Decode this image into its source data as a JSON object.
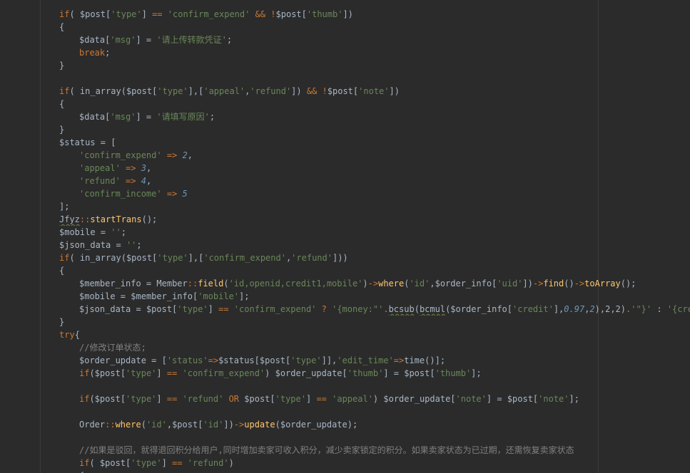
{
  "editor": {
    "colors": {
      "background": "#2b2b2b",
      "default_text": "#a9b7c6",
      "keyword": "#cc7832",
      "string": "#6a8759",
      "number": "#6897bb",
      "function": "#ffc66d",
      "comment": "#808080"
    },
    "lines": [
      {
        "indent": 7,
        "tokens": [
          [
            "kw",
            "if"
          ],
          [
            "punc",
            "( "
          ],
          [
            "var",
            "$post"
          ],
          [
            "punc",
            "["
          ],
          [
            "str",
            "'type'"
          ],
          [
            "punc",
            "] "
          ],
          [
            "op",
            "=="
          ],
          [
            "punc",
            " "
          ],
          [
            "str",
            "'confirm_expend'"
          ],
          [
            "punc",
            " "
          ],
          [
            "op",
            "&&"
          ],
          [
            "punc",
            " "
          ],
          [
            "op",
            "!"
          ],
          [
            "var",
            "$post"
          ],
          [
            "punc",
            "["
          ],
          [
            "str",
            "'thumb'"
          ],
          [
            "punc",
            "])"
          ]
        ]
      },
      {
        "indent": 7,
        "tokens": [
          [
            "punc",
            "{"
          ]
        ]
      },
      {
        "indent": 11,
        "tokens": [
          [
            "var",
            "$data"
          ],
          [
            "punc",
            "["
          ],
          [
            "str",
            "'msg'"
          ],
          [
            "punc",
            "] = "
          ],
          [
            "str",
            "'请上传转款凭证'"
          ],
          [
            "punc",
            ";"
          ]
        ]
      },
      {
        "indent": 11,
        "tokens": [
          [
            "kw",
            "break"
          ],
          [
            "punc",
            ";"
          ]
        ]
      },
      {
        "indent": 7,
        "tokens": [
          [
            "punc",
            "}"
          ]
        ]
      },
      {
        "indent": 7,
        "tokens": []
      },
      {
        "indent": 7,
        "tokens": [
          [
            "kw",
            "if"
          ],
          [
            "punc",
            "( "
          ],
          [
            "plain",
            "in_array("
          ],
          [
            "var",
            "$post"
          ],
          [
            "punc",
            "["
          ],
          [
            "str",
            "'type'"
          ],
          [
            "punc",
            "],["
          ],
          [
            "str",
            "'appeal'"
          ],
          [
            "punc",
            ","
          ],
          [
            "str",
            "'refund'"
          ],
          [
            "punc",
            "]) "
          ],
          [
            "op",
            "&&"
          ],
          [
            "punc",
            " "
          ],
          [
            "op",
            "!"
          ],
          [
            "var",
            "$post"
          ],
          [
            "punc",
            "["
          ],
          [
            "str",
            "'note'"
          ],
          [
            "punc",
            "])"
          ]
        ]
      },
      {
        "indent": 7,
        "tokens": [
          [
            "punc",
            "{"
          ]
        ]
      },
      {
        "indent": 11,
        "tokens": [
          [
            "var",
            "$data"
          ],
          [
            "punc",
            "["
          ],
          [
            "str",
            "'msg'"
          ],
          [
            "punc",
            "] = "
          ],
          [
            "str",
            "'请填写原因'"
          ],
          [
            "punc",
            ";"
          ]
        ]
      },
      {
        "indent": 7,
        "tokens": [
          [
            "punc",
            "}"
          ]
        ]
      },
      {
        "indent": 7,
        "tokens": [
          [
            "var",
            "$status"
          ],
          [
            "punc",
            " = ["
          ]
        ]
      },
      {
        "indent": 11,
        "tokens": [
          [
            "str",
            "'confirm_expend'"
          ],
          [
            "punc",
            " "
          ],
          [
            "op",
            "=>"
          ],
          [
            "punc",
            " "
          ],
          [
            "num",
            "2"
          ],
          [
            "punc",
            ","
          ]
        ]
      },
      {
        "indent": 11,
        "tokens": [
          [
            "str",
            "'appeal'"
          ],
          [
            "punc",
            " "
          ],
          [
            "op",
            "=>"
          ],
          [
            "punc",
            " "
          ],
          [
            "num",
            "3"
          ],
          [
            "punc",
            ","
          ]
        ]
      },
      {
        "indent": 11,
        "tokens": [
          [
            "str",
            "'refund'"
          ],
          [
            "punc",
            " "
          ],
          [
            "op",
            "=>"
          ],
          [
            "punc",
            " "
          ],
          [
            "num",
            "4"
          ],
          [
            "punc",
            ","
          ]
        ]
      },
      {
        "indent": 11,
        "tokens": [
          [
            "str",
            "'confirm_income'"
          ],
          [
            "punc",
            " "
          ],
          [
            "op",
            "=>"
          ],
          [
            "punc",
            " "
          ],
          [
            "num",
            "5"
          ]
        ]
      },
      {
        "indent": 7,
        "tokens": [
          [
            "punc",
            "];"
          ]
        ]
      },
      {
        "indent": 7,
        "tokens": [
          [
            "squig",
            "Jfyz"
          ],
          [
            "op",
            "::"
          ],
          [
            "fn",
            "startTrans"
          ],
          [
            "punc",
            "();"
          ]
        ]
      },
      {
        "indent": 7,
        "tokens": [
          [
            "var",
            "$mobile"
          ],
          [
            "punc",
            " = "
          ],
          [
            "str",
            "''"
          ],
          [
            "punc",
            ";"
          ]
        ]
      },
      {
        "indent": 7,
        "tokens": [
          [
            "var",
            "$json_data"
          ],
          [
            "punc",
            " = "
          ],
          [
            "str",
            "''"
          ],
          [
            "punc",
            ";"
          ]
        ]
      },
      {
        "indent": 7,
        "tokens": [
          [
            "kw",
            "if"
          ],
          [
            "punc",
            "( "
          ],
          [
            "plain",
            "in_array("
          ],
          [
            "var",
            "$post"
          ],
          [
            "punc",
            "["
          ],
          [
            "str",
            "'type'"
          ],
          [
            "punc",
            "],["
          ],
          [
            "str",
            "'confirm_expend'"
          ],
          [
            "punc",
            ","
          ],
          [
            "str",
            "'refund'"
          ],
          [
            "punc",
            "]))"
          ]
        ]
      },
      {
        "indent": 7,
        "tokens": [
          [
            "punc",
            "{"
          ]
        ]
      },
      {
        "indent": 11,
        "tokens": [
          [
            "var",
            "$member_info"
          ],
          [
            "punc",
            " = "
          ],
          [
            "cls",
            "Member"
          ],
          [
            "op",
            "::"
          ],
          [
            "fn",
            "field"
          ],
          [
            "punc",
            "("
          ],
          [
            "str",
            "'id,openid,credit1,mobile'"
          ],
          [
            "punc",
            ")"
          ],
          [
            "op",
            "->"
          ],
          [
            "fn",
            "where"
          ],
          [
            "punc",
            "("
          ],
          [
            "str",
            "'id'"
          ],
          [
            "punc",
            ","
          ],
          [
            "var",
            "$order_info"
          ],
          [
            "punc",
            "["
          ],
          [
            "str",
            "'uid'"
          ],
          [
            "punc",
            "])"
          ],
          [
            "op",
            "->"
          ],
          [
            "fn",
            "find"
          ],
          [
            "punc",
            "()"
          ],
          [
            "op",
            "->"
          ],
          [
            "fn",
            "toArray"
          ],
          [
            "punc",
            "();"
          ]
        ]
      },
      {
        "indent": 11,
        "tokens": [
          [
            "var",
            "$mobile"
          ],
          [
            "punc",
            " = "
          ],
          [
            "var",
            "$member_info"
          ],
          [
            "punc",
            "["
          ],
          [
            "str",
            "'mobile'"
          ],
          [
            "punc",
            "];"
          ]
        ]
      },
      {
        "indent": 11,
        "tokens": [
          [
            "var",
            "$json_data"
          ],
          [
            "punc",
            " = "
          ],
          [
            "var",
            "$post"
          ],
          [
            "punc",
            "["
          ],
          [
            "str",
            "'type'"
          ],
          [
            "punc",
            "] "
          ],
          [
            "op",
            "=="
          ],
          [
            "punc",
            " "
          ],
          [
            "str",
            "'confirm_expend'"
          ],
          [
            "punc",
            " "
          ],
          [
            "op",
            "?"
          ],
          [
            "punc",
            " "
          ],
          [
            "str",
            "'{money:\"'"
          ],
          [
            "op",
            "."
          ],
          [
            "squig",
            "bcsub"
          ],
          [
            "punc",
            "("
          ],
          [
            "squig",
            "bcmul"
          ],
          [
            "punc",
            "("
          ],
          [
            "var",
            "$order_info"
          ],
          [
            "punc",
            "["
          ],
          [
            "str",
            "'credit'"
          ],
          [
            "punc",
            "],"
          ],
          [
            "num",
            "0.97"
          ],
          [
            "punc",
            ","
          ],
          [
            "num",
            "2"
          ],
          [
            "punc",
            "),2,2)"
          ],
          [
            "op",
            "."
          ],
          [
            "str",
            "'\"}'"
          ],
          [
            "punc",
            " : "
          ],
          [
            "str",
            "'{credit"
          ]
        ]
      },
      {
        "indent": 7,
        "tokens": [
          [
            "punc",
            "}"
          ]
        ]
      },
      {
        "indent": 7,
        "tokens": [
          [
            "kw",
            "try"
          ],
          [
            "punc",
            "{"
          ]
        ]
      },
      {
        "indent": 11,
        "tokens": [
          [
            "cmt",
            "//修改订单状态;"
          ]
        ]
      },
      {
        "indent": 11,
        "tokens": [
          [
            "var",
            "$order_update"
          ],
          [
            "punc",
            " = ["
          ],
          [
            "str",
            "'status'"
          ],
          [
            "op",
            "=>"
          ],
          [
            "var",
            "$status"
          ],
          [
            "punc",
            "["
          ],
          [
            "var",
            "$post"
          ],
          [
            "punc",
            "["
          ],
          [
            "str",
            "'type'"
          ],
          [
            "punc",
            "]],"
          ],
          [
            "str",
            "'edit_time'"
          ],
          [
            "op",
            "=>"
          ],
          [
            "plain",
            "time()"
          ],
          [
            "punc",
            "];"
          ]
        ]
      },
      {
        "indent": 11,
        "tokens": [
          [
            "kw",
            "if"
          ],
          [
            "punc",
            "("
          ],
          [
            "var",
            "$post"
          ],
          [
            "punc",
            "["
          ],
          [
            "str",
            "'type'"
          ],
          [
            "punc",
            "] "
          ],
          [
            "op",
            "=="
          ],
          [
            "punc",
            " "
          ],
          [
            "str",
            "'confirm_expend'"
          ],
          [
            "punc",
            ") "
          ],
          [
            "var",
            "$order_update"
          ],
          [
            "punc",
            "["
          ],
          [
            "str",
            "'thumb'"
          ],
          [
            "punc",
            "] = "
          ],
          [
            "var",
            "$post"
          ],
          [
            "punc",
            "["
          ],
          [
            "str",
            "'thumb'"
          ],
          [
            "punc",
            "];"
          ]
        ]
      },
      {
        "indent": 11,
        "tokens": []
      },
      {
        "indent": 11,
        "tokens": [
          [
            "kw",
            "if"
          ],
          [
            "punc",
            "("
          ],
          [
            "var",
            "$post"
          ],
          [
            "punc",
            "["
          ],
          [
            "str",
            "'type'"
          ],
          [
            "punc",
            "] "
          ],
          [
            "op",
            "=="
          ],
          [
            "punc",
            " "
          ],
          [
            "str",
            "'refund'"
          ],
          [
            "punc",
            " "
          ],
          [
            "kw",
            "OR"
          ],
          [
            "punc",
            " "
          ],
          [
            "var",
            "$post"
          ],
          [
            "punc",
            "["
          ],
          [
            "str",
            "'type'"
          ],
          [
            "punc",
            "] "
          ],
          [
            "op",
            "=="
          ],
          [
            "punc",
            " "
          ],
          [
            "str",
            "'appeal'"
          ],
          [
            "punc",
            ") "
          ],
          [
            "var",
            "$order_update"
          ],
          [
            "punc",
            "["
          ],
          [
            "str",
            "'note'"
          ],
          [
            "punc",
            "] = "
          ],
          [
            "var",
            "$post"
          ],
          [
            "punc",
            "["
          ],
          [
            "str",
            "'note'"
          ],
          [
            "punc",
            "];"
          ]
        ]
      },
      {
        "indent": 11,
        "tokens": []
      },
      {
        "indent": 11,
        "tokens": [
          [
            "cls",
            "Order"
          ],
          [
            "op",
            "::"
          ],
          [
            "fn",
            "where"
          ],
          [
            "punc",
            "("
          ],
          [
            "str",
            "'id'"
          ],
          [
            "punc",
            ","
          ],
          [
            "var",
            "$post"
          ],
          [
            "punc",
            "["
          ],
          [
            "str",
            "'id'"
          ],
          [
            "punc",
            "])"
          ],
          [
            "op",
            "->"
          ],
          [
            "fn",
            "update"
          ],
          [
            "punc",
            "("
          ],
          [
            "var",
            "$order_update"
          ],
          [
            "punc",
            ");"
          ]
        ]
      },
      {
        "indent": 11,
        "tokens": []
      },
      {
        "indent": 11,
        "tokens": [
          [
            "cmt",
            "//如果是驳回，就得退回积分给用户,同时增加卖家可收入积分，减少卖家锁定的积分。如果卖家状态为已过期，还需恢复卖家状态"
          ]
        ]
      },
      {
        "indent": 11,
        "tokens": [
          [
            "kw",
            "if"
          ],
          [
            "punc",
            "( "
          ],
          [
            "var",
            "$post"
          ],
          [
            "punc",
            "["
          ],
          [
            "str",
            "'type'"
          ],
          [
            "punc",
            "] "
          ],
          [
            "op",
            "=="
          ],
          [
            "punc",
            " "
          ],
          [
            "str",
            "'refund'"
          ],
          [
            "punc",
            ")"
          ]
        ]
      },
      {
        "indent": 11,
        "tokens": [
          [
            "punc",
            "{"
          ]
        ]
      }
    ]
  }
}
